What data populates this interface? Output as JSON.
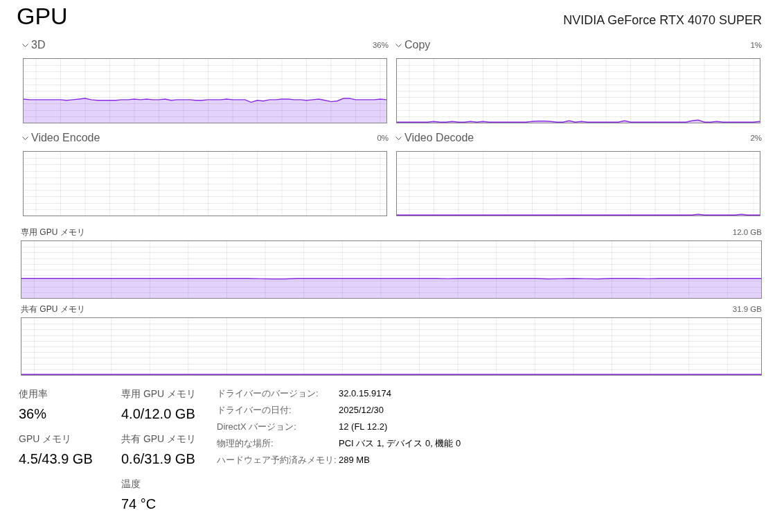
{
  "title": "GPU",
  "adapter_name": "NVIDIA GeForce RTX 4070 SUPER",
  "engine_graphs": [
    {
      "name": "3D",
      "reading": "36%"
    },
    {
      "name": "Copy",
      "reading": "1%"
    },
    {
      "name": "Video Encode",
      "reading": "0%"
    },
    {
      "name": "Video Decode",
      "reading": "2%"
    }
  ],
  "memory_graphs": [
    {
      "name": "専用 GPU メモリ",
      "reading": "12.0 GB"
    },
    {
      "name": "共有 GPU メモリ",
      "reading": "31.9 GB"
    }
  ],
  "stat_columns": [
    [
      {
        "label": "使用率",
        "value": "36%"
      },
      {
        "label": "GPU メモリ",
        "value": "4.5/43.9 GB"
      }
    ],
    [
      {
        "label": "専用 GPU メモリ",
        "value": "4.0/12.0 GB"
      },
      {
        "label": "共有 GPU メモリ",
        "value": "0.6/31.9 GB"
      },
      {
        "label": "温度",
        "value": "74 °C"
      }
    ]
  ],
  "details": [
    {
      "label": "ドライバーのバージョン:",
      "value": "32.0.15.9174"
    },
    {
      "label": "ドライバーの日付:",
      "value": "2025/12/30"
    },
    {
      "label": "DirectX バージョン:",
      "value": "12 (FL 12.2)"
    },
    {
      "label": "物理的な場所:",
      "value": "PCI バス 1, デバイス 0, 機能 0"
    },
    {
      "label": "ハードウェア予約済みメモリ:",
      "value": "289 MB"
    }
  ]
}
